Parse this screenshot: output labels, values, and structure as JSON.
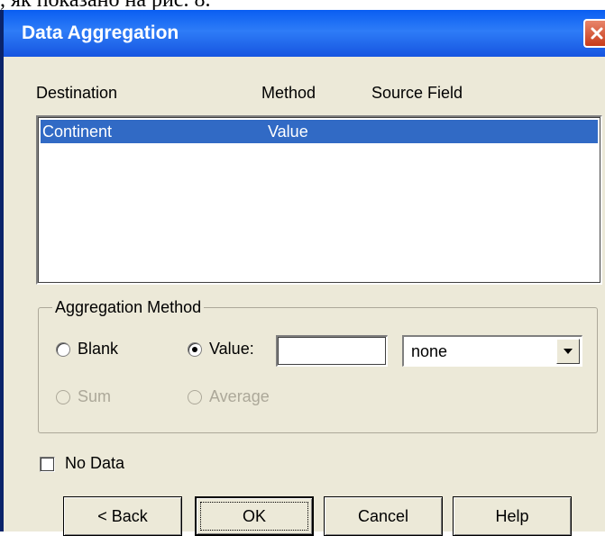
{
  "page_caption": ", як показано на рис. 8.",
  "window": {
    "title": "Data Aggregation"
  },
  "columns": {
    "destination": "Destination",
    "method": "Method",
    "source_field": "Source Field"
  },
  "list": {
    "rows": [
      {
        "destination": "Continent",
        "method": "Value",
        "source_field": ""
      }
    ]
  },
  "aggregation": {
    "group_label": "Aggregation Method",
    "blank_label": "Blank",
    "value_label": "Value:",
    "value_input": "",
    "combo_value": "none",
    "sum_label": "Sum",
    "average_label": "Average",
    "selected": "Value"
  },
  "no_data": {
    "label": "No Data",
    "checked": false
  },
  "buttons": {
    "back": "< Back",
    "ok": "OK",
    "cancel": "Cancel",
    "help": "Help"
  },
  "colors": {
    "title_bar": "#0a5ef2",
    "selection": "#316ac5",
    "dialog_bg": "#ece9d8",
    "close_button": "#c73b1a"
  }
}
